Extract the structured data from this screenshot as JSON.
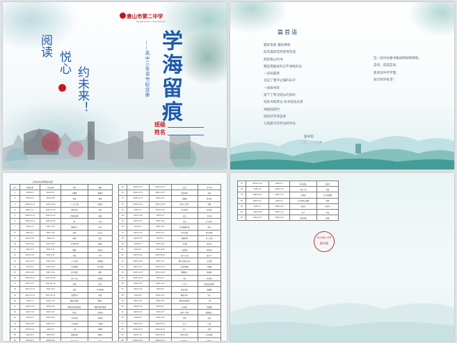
{
  "cover": {
    "school_name": "唐山市第二中学",
    "school_en": "Tangshan No.2 High School",
    "title": "学海留痕",
    "subtitle": "——高中三年读书纪念册",
    "slogan": [
      "阅读",
      "悦心",
      "约未来！"
    ],
    "fields": [
      "班级",
      "姓名"
    ]
  },
  "preface": {
    "heading": "篇首语",
    "lines": [
      "最好笔者 难知事情",
      "既有喜默无所取侍花成",
      "明后看过的书",
      "都是用图采的记不清晰的光",
      "一段段篇章",
      "见证了我学过满的日子",
      "一排排书架",
      "留下了青涩成长的景彩",
      "经朱书笔带过 条书成龙光谱",
      "海桃成就时",
      "连知开学诗哲草",
      "让阳晨子开时光好时光"
    ],
    "right_lines": [
      "在一段时光摩书集择物知物物取，",
      "自然，成成自发，",
      "素阅读中学学理，",
      "知识和学家求！"
    ],
    "sign_org": "图书馆",
    "sign_date": "二零二八年五月"
  },
  "list_caption": "三年读书记录阅读书目",
  "list_headers": [
    "序号",
    "借阅日期",
    "归还日期",
    "书名",
    "著者"
  ],
  "list_left": [
    [
      "1",
      "2020.9.3",
      "2020.9.17",
      "红楼梦",
      "曹雪芹"
    ],
    [
      "2",
      "2020.9.21",
      "2020.10.8",
      "雷雨",
      "曹禺"
    ],
    [
      "3",
      "2020.10.12",
      "2020.10.30",
      "《一九八四》·",
      "奥威尔"
    ],
    [
      "4",
      "2020.11.2",
      "2020.11.20",
      "朝花夕拾",
      "鲁迅"
    ],
    [
      "5",
      "2020.11.23",
      "2020.12.10",
      "巴黎圣母院",
      "雨果"
    ],
    [
      "6",
      "2020.12.14",
      "2020.12.29",
      "家",
      "巴金"
    ],
    [
      "7",
      "2021.1.4",
      "2021.1.20",
      "骆驼祥子",
      "老舍"
    ],
    [
      "8",
      "2021.3.1",
      "2021.3.18",
      "边城",
      "沈从文"
    ],
    [
      "9",
      "2021.3.22",
      "2021.4.9",
      "呐喊",
      "鲁迅"
    ],
    [
      "10",
      "2021.4.12",
      "2021.4.30",
      "平凡的世界",
      "路遥"
    ],
    [
      "11",
      "2021.5.6",
      "2021.5.21",
      "围城",
      "钱钟书"
    ],
    [
      "12",
      "2021.5.24",
      "2021.6.11",
      "活着",
      "余华"
    ],
    [
      "13",
      "2021.6.15",
      "2021.6.30",
      "乡土中国",
      "费孝通"
    ],
    [
      "14",
      "2021.9.2",
      "2021.9.18",
      "百年孤独",
      "马尔克斯"
    ],
    [
      "15",
      "2021.9.22",
      "2021.10.9",
      "瓦尔登湖",
      "梭罗"
    ],
    [
      "16",
      "2021.10.12",
      "2021.10.29",
      "老人与海",
      "海明威"
    ],
    [
      "17",
      "2021.11.1",
      "2021.11.19",
      "茶馆",
      "老舍"
    ],
    [
      "18",
      "2021.11.22",
      "2021.12.9",
      "复活",
      "托尔斯泰"
    ],
    [
      "19",
      "2021.12.13",
      "2021.12.30",
      "悲惨世界",
      "雨果"
    ],
    [
      "20",
      "2022.1.3",
      "2022.1.19",
      "傲慢与偏见",
      "奥斯汀"
    ],
    [
      "21",
      "2022.2.21",
      "2022.3.10",
      "钢铁是怎样炼成的",
      "奥斯特洛夫斯基"
    ],
    [
      "22",
      "2022.3.14",
      "2022.3.31",
      "简·爱",
      "夏洛蒂"
    ],
    [
      "23",
      "2022.4.5",
      "2022.4.22",
      "文化苦旅",
      "余秋雨"
    ],
    [
      "24",
      "2022.4.25",
      "2022.5.12",
      "人间词话",
      "王国维"
    ],
    [
      "25",
      "2022.5.16",
      "2022.6.2",
      "三体",
      "刘慈欣"
    ],
    [
      "26",
      "2022.6.6",
      "2022.6.23",
      "城南旧事",
      "林海音"
    ],
    [
      "27",
      "2022.9.1",
      "2022.9.16",
      "呼兰河传",
      "萧红"
    ],
    [
      "28",
      "2022.9.19",
      "2022.10.7",
      "目送",
      "龙应台"
    ]
  ],
  "list_right": [
    [
      "29",
      "2022.10.10",
      "2022.10.27",
      "红岩",
      "罗广斌"
    ],
    [
      "30",
      "2022.10.31",
      "2022.11.17",
      "四世同堂",
      "老舍"
    ],
    [
      "31",
      "2022.11.21",
      "2022.12.8",
      "白鹿原",
      "陈忠实"
    ],
    [
      "32",
      "2022.12.12",
      "2022.12.29",
      "月亮与六便士",
      "毛姆"
    ],
    [
      "33",
      "2023.1.3",
      "2023.1.18",
      "苏东坡传",
      "林语堂"
    ],
    [
      "34",
      "2023.2.20",
      "2023.3.9",
      "史记",
      "司马迁"
    ],
    [
      "35",
      "2023.3.13",
      "2023.3.30",
      "论语",
      "孔子弟子"
    ],
    [
      "36",
      "2023.4.3",
      "2023.4.20",
      "红星照耀中国",
      "斯诺"
    ],
    [
      "37",
      "2023.4.24",
      "2023.5.11",
      "堂吉诃德",
      "塞万提斯"
    ],
    [
      "38",
      "2023.5.15",
      "2023.6.1",
      "哈姆雷特",
      "莎士比亚"
    ],
    [
      "39",
      "2023.6.5",
      "2023.6.21",
      "飞鸟集",
      "泰戈尔"
    ],
    [
      "40",
      "2023.9.4",
      "2023.9.20",
      "人类简史",
      "赫拉利"
    ],
    [
      "41",
      "2023.9.25",
      "2023.10.12",
      "万历十五年",
      "黄仁宇"
    ],
    [
      "42",
      "2023.10.16",
      "2023.11.2",
      "额尔古纳河右岸",
      "迟子建"
    ],
    [
      "43",
      "2023.11.6",
      "2023.11.23",
      "长安的荔枝",
      "马伯庸"
    ],
    [
      "44",
      "2023.11.27",
      "2023.12.14",
      "雾都孤儿",
      "狄更斯"
    ],
    [
      "45",
      "2023.12.18",
      "2024.1.4",
      "牛虻",
      "伏尼契"
    ],
    [
      "46",
      "2024.2.26",
      "2024.3.14",
      "小王子",
      "圣埃克苏佩里"
    ],
    [
      "47",
      "2024.3.18",
      "2024.4.4",
      "娱乐至死",
      "波兹曼"
    ],
    [
      "48",
      "2024.4.8",
      "2024.4.25",
      "繁星·春水",
      "冰心"
    ],
    [
      "49",
      "2024.4.29",
      "2024.5.16",
      "撒哈拉的故事",
      "三毛"
    ],
    [
      "50",
      "2024.5.20",
      "2024.6.6",
      "宋词选",
      "胡云翼"
    ],
    [
      "51",
      "2024.6.10",
      "2024.6.27",
      "唐诗三百首",
      "蘅塘退士"
    ],
    [
      "52",
      "2024.9.2",
      "2024.9.19",
      "诗经",
      "佚名"
    ],
    [
      "53",
      "2024.9.23",
      "2024.10.10",
      "庄子",
      "庄周"
    ],
    [
      "54",
      "2024.10.14",
      "2024.10.31",
      "孟子",
      "孟轲"
    ],
    [
      "55",
      "2024.11.4",
      "2024.11.21",
      "战争与和平",
      "托尔斯泰"
    ],
    [
      "56",
      "2024.11.25",
      "2024.12.12",
      "追风筝的人",
      "胡赛尼"
    ]
  ],
  "list_p4": [
    [
      "57",
      "2024.12.16",
      "2025.1.2",
      "我与地坛",
      "史铁生"
    ],
    [
      "58",
      "2025.1.6",
      "2025.1.23",
      "浮生六记",
      "沈复"
    ],
    [
      "59",
      "2025.2.24",
      "2025.3.13",
      "沉思录",
      "马可·奥勒留"
    ],
    [
      "60",
      "2025.3.17",
      "2025.4.3",
      "少年维特之烦恼",
      "歌德"
    ],
    [
      "61",
      "2025.4.7",
      "2025.4.24",
      "昆虫记",
      "法布尔"
    ],
    [
      "62",
      "2025.4.28",
      "2025.5.15",
      "老子",
      "李耳"
    ],
    [
      "63",
      "2025.5.19",
      "2025.5.30",
      "青春之歌",
      "杨沫"
    ]
  ],
  "stamp": {
    "org": "唐山市第二中学",
    "label": "图书馆"
  }
}
